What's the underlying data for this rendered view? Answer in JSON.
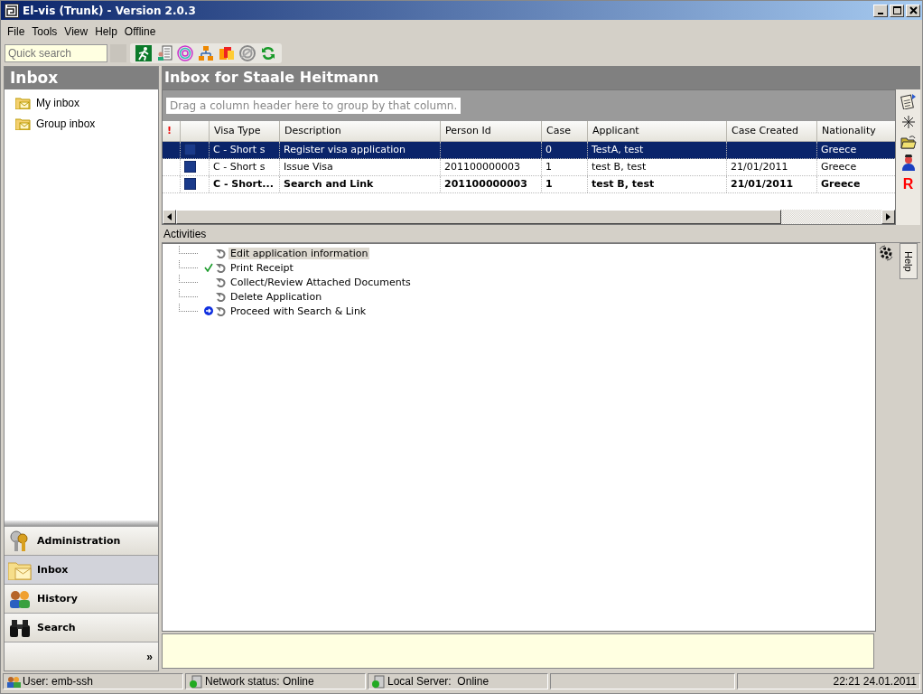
{
  "window": {
    "title": "El-vis (Trunk) - Version 2.0.3"
  },
  "menu": [
    "File",
    "Tools",
    "View",
    "Help",
    "Offline"
  ],
  "quick_search": {
    "placeholder": "Quick search"
  },
  "sidebar": {
    "title": "Inbox",
    "tree": [
      {
        "label": "My inbox",
        "selected": false
      },
      {
        "label": "Group inbox",
        "selected": false
      }
    ],
    "nav": [
      {
        "label": "Administration",
        "kind": "keys",
        "selected": false
      },
      {
        "label": "Inbox",
        "kind": "inbox",
        "selected": true
      },
      {
        "label": "History",
        "kind": "people",
        "selected": false
      },
      {
        "label": "Search",
        "kind": "binoculars",
        "selected": false
      }
    ],
    "more": "»"
  },
  "main": {
    "title": "Inbox for Staale Heitmann",
    "group_hint": "Drag a column header here to group by that column.",
    "columns": [
      "!",
      "",
      "Visa Type",
      "Description",
      "Person Id",
      "Case",
      "Applicant",
      "Case Created",
      "Nationality"
    ],
    "rows": [
      {
        "cells": [
          "",
          "",
          "C - Short s",
          "Register visa application",
          "",
          "0",
          "TestA, test",
          "",
          "Greece"
        ],
        "selected": true,
        "unread": false
      },
      {
        "cells": [
          "",
          "",
          "C - Short s",
          "Issue Visa",
          "201100000003",
          "1",
          "test B, test",
          "21/01/2011",
          "Greece"
        ],
        "selected": false,
        "unread": false
      },
      {
        "cells": [
          "",
          "",
          "C - Short...",
          "Search and Link",
          "201100000003",
          "1",
          "test B, test",
          "21/01/2011",
          "Greece"
        ],
        "selected": false,
        "unread": true
      }
    ],
    "side_letter": "R"
  },
  "activities": {
    "title": "Activities",
    "side_tab": "Help",
    "items": [
      {
        "label": "Edit application information",
        "checked": false,
        "current": false,
        "selected": true
      },
      {
        "label": "Print Receipt",
        "checked": true,
        "current": false,
        "selected": false
      },
      {
        "label": "Collect/Review Attached Documents",
        "checked": false,
        "current": false,
        "selected": false
      },
      {
        "label": "Delete Application",
        "checked": false,
        "current": false,
        "selected": false
      },
      {
        "label": "Proceed with Search & Link",
        "checked": false,
        "current": true,
        "selected": false
      }
    ]
  },
  "status_bar": {
    "user": "User: emb-ssh",
    "network": "Network status: Online",
    "server": "Local Server:  Online",
    "clock": "22:21 24.01.2011"
  }
}
